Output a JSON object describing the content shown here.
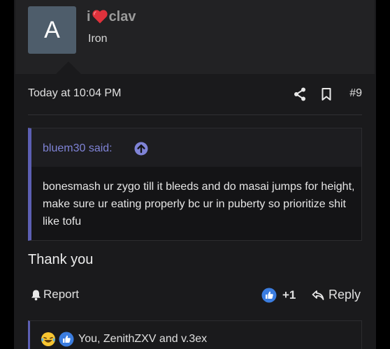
{
  "user": {
    "avatar_letter": "A",
    "name_prefix": "i",
    "name_suffix": "clav",
    "title": "Iron"
  },
  "post": {
    "date": "Today at 10:04 PM",
    "number": "#9",
    "quote": {
      "author": "bluem30 said:",
      "text": "bonesmash ur zygo till it bleeds and do masai jumps for height, make sure ur eating properly bc ur in puberty so prioritize shit like tofu"
    },
    "message": "Thank you"
  },
  "actions": {
    "report_label": "Report",
    "like_count": "+1",
    "reply_label": "Reply"
  },
  "reactions": {
    "text": "You, ZenithZXV and v.3ex"
  },
  "icons": [
    "heart-icon",
    "share-icon",
    "bookmark-icon",
    "arrow-up-icon",
    "bell-icon",
    "like-icon",
    "reply-icon",
    "laugh-cry-icon"
  ],
  "colors": {
    "accent": "#5c5fb3",
    "quote_author": "#7f83d6",
    "like_blue": "#3b7de0",
    "heart_red": "#e0323c"
  }
}
